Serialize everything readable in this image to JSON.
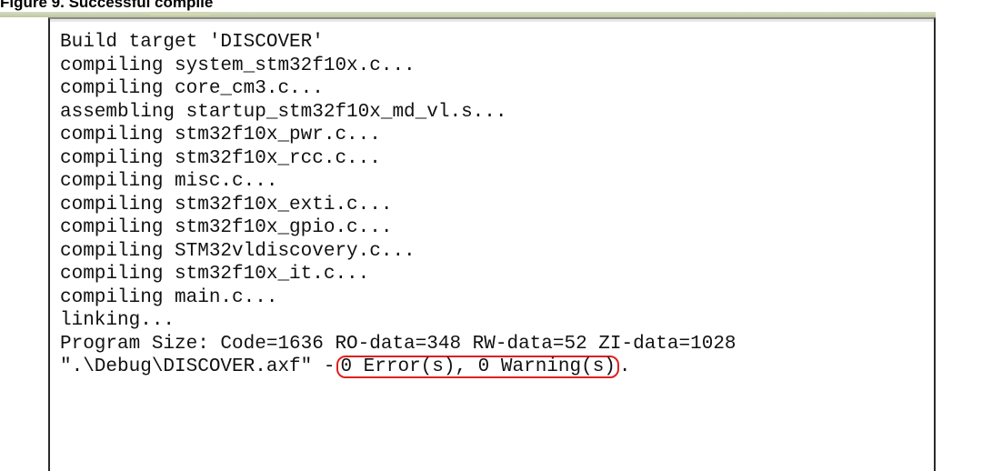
{
  "caption": {
    "text": "Figure 9. Successful compile"
  },
  "log": {
    "lines": [
      "Build target 'DISCOVER'",
      "compiling system_stm32f10x.c...",
      "compiling core_cm3.c...",
      "assembling startup_stm32f10x_md_vl.s...",
      "compiling stm32f10x_pwr.c...",
      "compiling stm32f10x_rcc.c...",
      "compiling misc.c...",
      "compiling stm32f10x_exti.c...",
      "compiling stm32f10x_gpio.c...",
      "compiling STM32vldiscovery.c...",
      "compiling stm32f10x_it.c...",
      "compiling main.c...",
      "linking...",
      "Program Size: Code=1636 RO-data=348 RW-data=52 ZI-data=1028"
    ],
    "final_prefix": "\".\\Debug\\DISCOVER.axf\" -",
    "final_result": "0 Error(s), 0 Warning(s)",
    "final_suffix": "."
  },
  "colors": {
    "highlight_border": "#e02020",
    "topbar": "#bcc6a0"
  }
}
